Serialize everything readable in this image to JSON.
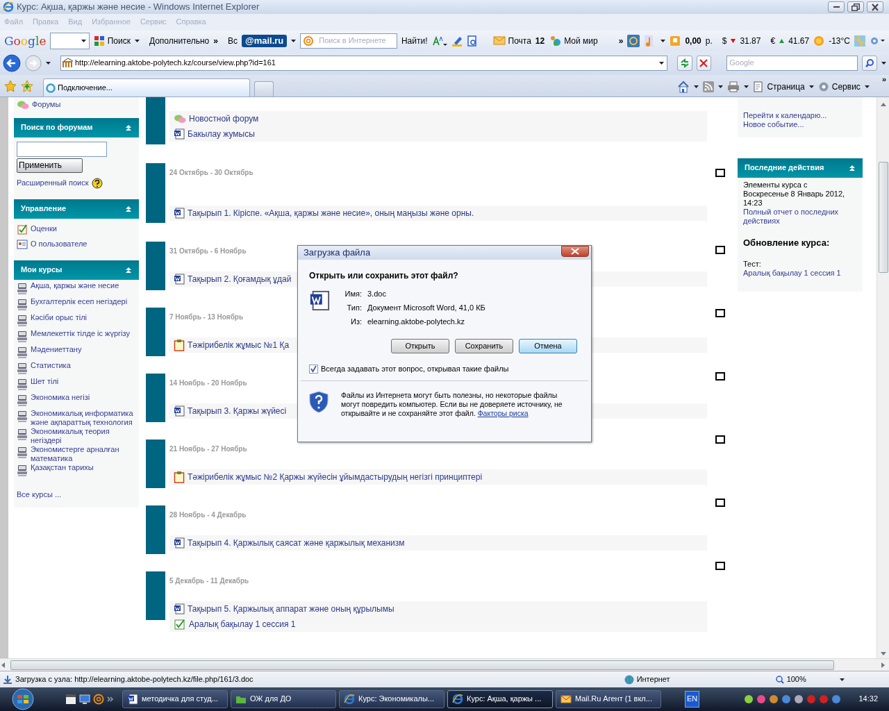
{
  "window": {
    "title": "Курс: Ақша, қаржы және несие - Windows Internet Explorer"
  },
  "menu": [
    {
      "label": "Файл",
      "disabled": true
    },
    {
      "label": "Правка",
      "disabled": true
    },
    {
      "label": "Вид",
      "disabled": true
    },
    {
      "label": "Избранное",
      "disabled": true
    },
    {
      "label": "Сервис",
      "disabled": true
    },
    {
      "label": "Справка",
      "disabled": true
    }
  ],
  "toolbar": {
    "google_logo": "Google",
    "search_button": "Поиск",
    "more": "Дополнительно",
    "more_chevron": "»",
    "vs": "Вс",
    "mail_logo": "@mail.ru",
    "search_placeholder": "Поиск в Интернете",
    "find_button": "Найти!",
    "mail_label": "Почта",
    "mail_count": "12",
    "my_world": "Мой мир",
    "chevron": "»",
    "balance": "0,00",
    "balance_unit": "р.",
    "usd_symbol": "$",
    "usd": "31.87",
    "eur_symbol": "€",
    "eur": "41.67",
    "weather": "-13°C"
  },
  "address": {
    "url": "http://elearning.aktobe-polytech.kz/course/view.php?id=161",
    "search_placeholder": "Google"
  },
  "tabs": [
    {
      "label": "Подключение...",
      "selected": true
    }
  ],
  "command_bar": {
    "page": "Страница",
    "tools": "Сервис",
    "chevron": "»"
  },
  "sidebar": {
    "top_item": "Форумы",
    "blocks": [
      {
        "title": "Поиск по форумам",
        "kind": "search",
        "button": "Применить",
        "link": "Расширенный поиск"
      },
      {
        "title": "Управление",
        "kind": "links",
        "items": [
          {
            "label": "Оценки",
            "kind": "grades"
          },
          {
            "label": "О пользователе",
            "kind": "profile"
          }
        ]
      },
      {
        "title": "Мои курсы",
        "kind": "courses",
        "items": [
          "Ақша, қаржы және несие",
          "Бухгалтерлік есеп негіздері",
          "Кәсіби орыс тілі",
          "Мемлекеттік тілде іс жүргізу",
          "Мәдениеттану",
          "Статистика",
          "Шет тілі",
          "Экономика негізі",
          "Экономикалық информатика және ақпараттық технология",
          "Экономикалық теория негіздері",
          "Экономистерге арналған математика",
          "Қазақстан тарихы"
        ],
        "footer": "Все курсы ..."
      }
    ]
  },
  "sections": [
    {
      "items": [
        {
          "label": "Новостной форум",
          "kind": "forum"
        },
        {
          "label": "Бакылау жумысы",
          "kind": "word"
        }
      ]
    },
    {
      "date": "24 Октябрь - 30 Октябрь",
      "highlighted": false,
      "items": [
        {
          "label": "Тақырып 1. Кіріспе. «Ақша, қаржы және несие», оның маңызы және орны.",
          "kind": "word"
        }
      ]
    },
    {
      "date": "31 Октябрь - 6 Ноябрь",
      "highlighted": false,
      "items": [
        {
          "label": "Тақырып 2. Қоғамдық ұдай",
          "kind": "word"
        }
      ]
    },
    {
      "date": "7 Ноябрь - 13 Ноябрь",
      "highlighted": false,
      "items": [
        {
          "label": "Тәжірибелік жұмыс №1 Қа",
          "kind": "assignment"
        }
      ]
    },
    {
      "date": "14 Ноябрь - 20 Ноябрь",
      "highlighted": false,
      "items": [
        {
          "label": "Тақырып 3. Қаржы жүйесі",
          "kind": "word"
        }
      ]
    },
    {
      "date": "21 Ноябрь - 27 Ноябрь",
      "highlighted": false,
      "items": [
        {
          "label": "Тәжірибелік жұмыс №2 Қаржы жүйесін ұйымдастырудың негізгі принциптері",
          "kind": "assignment"
        }
      ]
    },
    {
      "date": "28 Ноябрь - 4 Декабрь",
      "highlighted": false,
      "items": [
        {
          "label": "Тақырып 4. Қаржылық саясат және қаржылық механизм",
          "kind": "word"
        }
      ]
    },
    {
      "date": "5 Декабрь - 11 Декабрь",
      "highlighted": false,
      "items": [
        {
          "label": "Тақырып 5. Қаржылық аппарат және оның құрылымы",
          "kind": "word"
        },
        {
          "label": "Аралық бақылау 1 сессия 1",
          "kind": "quiz"
        }
      ]
    }
  ],
  "right": {
    "calendar_links": [
      "Перейти к календарю...",
      "Новое событие..."
    ],
    "recent": {
      "title": "Последние действия",
      "since": "Элементы курса с Воскресенье 8 Январь 2012, 14:23",
      "full_report": "Полный отчет о последних действиях",
      "updates_heading": "Обновление курса:",
      "update_label": "Тест:",
      "update_link": "Аралық бақылау 1 сессия 1"
    }
  },
  "dialog": {
    "title": "Загрузка файла",
    "question": "Открыть или сохранить этот файл?",
    "fields": [
      {
        "label": "Имя:",
        "value": "3.doc"
      },
      {
        "label": "Тип:",
        "value": "Документ Microsoft Word, 41,0 КБ"
      },
      {
        "label": "Из:",
        "value": "elearning.aktobe-polytech.kz"
      }
    ],
    "buttons": [
      {
        "label": "Открыть",
        "selected": false
      },
      {
        "label": "Сохранить",
        "selected": false
      },
      {
        "label": "Отмена",
        "selected": true
      }
    ],
    "always_ask": {
      "label": "Всегда задавать этот вопрос, открывая такие файлы",
      "checked": true
    },
    "warning": "Файлы из Интернета могут быть полезны, но некоторые файлы могут повредить компьютер. Если вы не доверяете источнику, не открывайте и не сохраняйте этот файл.",
    "risk_link": "Факторы риска"
  },
  "status": {
    "text": "Загрузка с узла: http://elearning.aktobe-polytech.kz/file.php/161/3.doc",
    "zone": "Интернет",
    "zoom": "100%"
  },
  "taskbar": {
    "tasks": [
      {
        "label": "методичка для студ...",
        "kind": "word",
        "selected": false
      },
      {
        "label": "ОЖ  для ДО",
        "kind": "folder",
        "selected": false
      },
      {
        "label": "Курс: Экономикалы...",
        "kind": "ie",
        "selected": false
      },
      {
        "label": "Курс: Ақша, қаржы ...",
        "kind": "ie",
        "selected": true
      },
      {
        "label": "Mail.Ru Агент (1 вкл...",
        "kind": "mail",
        "selected": false
      }
    ],
    "language": "EN",
    "clock": "14:32"
  }
}
